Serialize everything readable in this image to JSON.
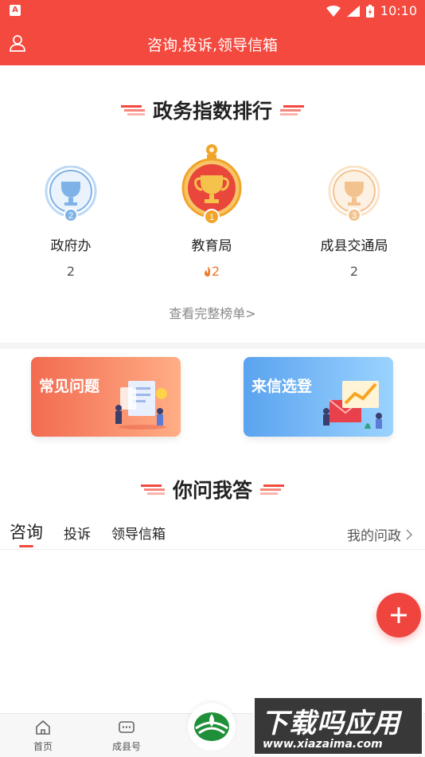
{
  "status_bar": {
    "app_badge": "A",
    "time": "10:10"
  },
  "header": {
    "title": "咨询,投诉,领导信箱",
    "user_icon": "user-icon"
  },
  "ranking": {
    "title": "政务指数排行",
    "items": [
      {
        "rank": "2",
        "name": "政府办",
        "score": "2"
      },
      {
        "rank": "1",
        "name": "教育局",
        "score": "2"
      },
      {
        "rank": "3",
        "name": "成县交通局",
        "score": "2"
      }
    ],
    "view_all": "查看完整榜单>"
  },
  "cards": [
    {
      "label": "常见问题"
    },
    {
      "label": "来信选登"
    }
  ],
  "qa": {
    "title": "你问我答",
    "tabs": [
      "咨询",
      "投诉",
      "领导信箱"
    ],
    "my_questions": "我的问政"
  },
  "bottom_nav": [
    {
      "label": "首页",
      "icon": "home-icon"
    },
    {
      "label": "成县号",
      "icon": "chat-icon"
    }
  ],
  "watermark": {
    "big": "下载吗应用",
    "small": "www.xiazaima.com"
  },
  "colors": {
    "brand": "#f4493e",
    "gold": "#f0a52a",
    "silver_blue": "#7fb2e6",
    "bronze": "#f3c38f"
  }
}
